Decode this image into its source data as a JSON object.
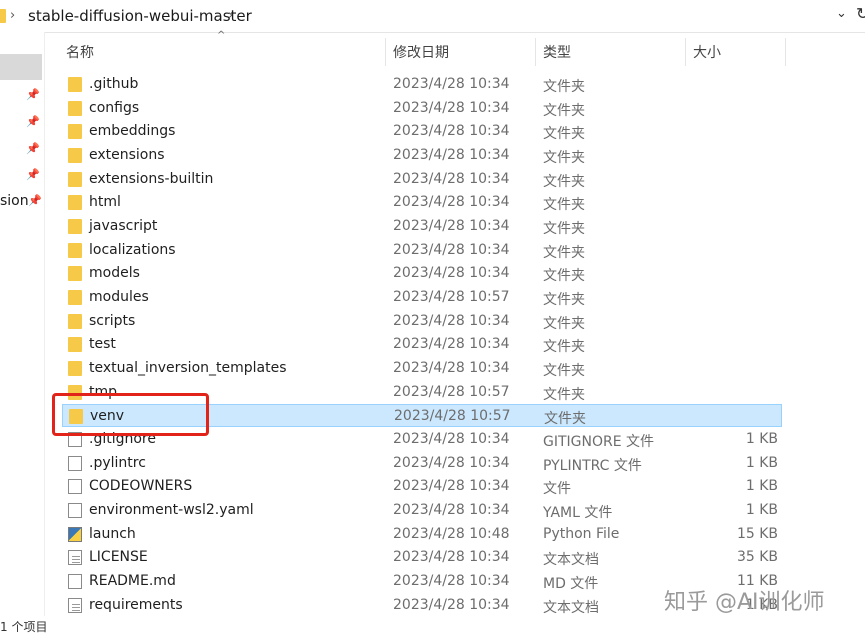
{
  "address": {
    "breadcrumb": "stable-diffusion-webui-master",
    "chevron": "›",
    "dropdown_icon": "chevron-down-icon",
    "refresh_icon": "refresh-icon"
  },
  "nav": {
    "partial_label": "sion",
    "pin_icon": "pin-icon"
  },
  "columns": {
    "name": "名称",
    "modified": "修改日期",
    "type": "类型",
    "size": "大小"
  },
  "files": [
    {
      "name": ".github",
      "modified": "2023/4/28 10:34",
      "type": "文件夹",
      "size": "",
      "icon": "folder-icon"
    },
    {
      "name": "configs",
      "modified": "2023/4/28 10:34",
      "type": "文件夹",
      "size": "",
      "icon": "folder-icon"
    },
    {
      "name": "embeddings",
      "modified": "2023/4/28 10:34",
      "type": "文件夹",
      "size": "",
      "icon": "folder-icon"
    },
    {
      "name": "extensions",
      "modified": "2023/4/28 10:34",
      "type": "文件夹",
      "size": "",
      "icon": "folder-icon"
    },
    {
      "name": "extensions-builtin",
      "modified": "2023/4/28 10:34",
      "type": "文件夹",
      "size": "",
      "icon": "folder-icon"
    },
    {
      "name": "html",
      "modified": "2023/4/28 10:34",
      "type": "文件夹",
      "size": "",
      "icon": "folder-icon"
    },
    {
      "name": "javascript",
      "modified": "2023/4/28 10:34",
      "type": "文件夹",
      "size": "",
      "icon": "folder-icon"
    },
    {
      "name": "localizations",
      "modified": "2023/4/28 10:34",
      "type": "文件夹",
      "size": "",
      "icon": "folder-icon"
    },
    {
      "name": "models",
      "modified": "2023/4/28 10:34",
      "type": "文件夹",
      "size": "",
      "icon": "folder-icon"
    },
    {
      "name": "modules",
      "modified": "2023/4/28 10:57",
      "type": "文件夹",
      "size": "",
      "icon": "folder-icon"
    },
    {
      "name": "scripts",
      "modified": "2023/4/28 10:34",
      "type": "文件夹",
      "size": "",
      "icon": "folder-icon"
    },
    {
      "name": "test",
      "modified": "2023/4/28 10:34",
      "type": "文件夹",
      "size": "",
      "icon": "folder-icon"
    },
    {
      "name": "textual_inversion_templates",
      "modified": "2023/4/28 10:34",
      "type": "文件夹",
      "size": "",
      "icon": "folder-icon"
    },
    {
      "name": "tmp",
      "modified": "2023/4/28 10:57",
      "type": "文件夹",
      "size": "",
      "icon": "folder-icon"
    },
    {
      "name": "venv",
      "modified": "2023/4/28 10:57",
      "type": "文件夹",
      "size": "",
      "icon": "folder-icon",
      "selected": true
    },
    {
      "name": ".gitignore",
      "modified": "2023/4/28 10:34",
      "type": "GITIGNORE 文件",
      "size": "1 KB",
      "icon": "file-icon"
    },
    {
      "name": ".pylintrc",
      "modified": "2023/4/28 10:34",
      "type": "PYLINTRC 文件",
      "size": "1 KB",
      "icon": "file-icon"
    },
    {
      "name": "CODEOWNERS",
      "modified": "2023/4/28 10:34",
      "type": "文件",
      "size": "1 KB",
      "icon": "file-icon"
    },
    {
      "name": "environment-wsl2.yaml",
      "modified": "2023/4/28 10:34",
      "type": "YAML 文件",
      "size": "1 KB",
      "icon": "file-icon"
    },
    {
      "name": "launch",
      "modified": "2023/4/28 10:48",
      "type": "Python File",
      "size": "15 KB",
      "icon": "python-file-icon"
    },
    {
      "name": "LICENSE",
      "modified": "2023/4/28 10:34",
      "type": "文本文档",
      "size": "35 KB",
      "icon": "text-document-icon"
    },
    {
      "name": "README.md",
      "modified": "2023/4/28 10:34",
      "type": "MD 文件",
      "size": "11 KB",
      "icon": "file-icon"
    },
    {
      "name": "requirements",
      "modified": "2023/4/28 10:34",
      "type": "文本文档",
      "size": "1 KB",
      "icon": "text-document-icon"
    }
  ],
  "status": {
    "count_text": "1 个项目"
  },
  "watermark": "知乎 @AI训化师",
  "colors": {
    "selection_bg": "#cce8ff",
    "selection_border": "#99d1ff",
    "annotation_box": "#e2231a",
    "folder": "#f7c948"
  }
}
